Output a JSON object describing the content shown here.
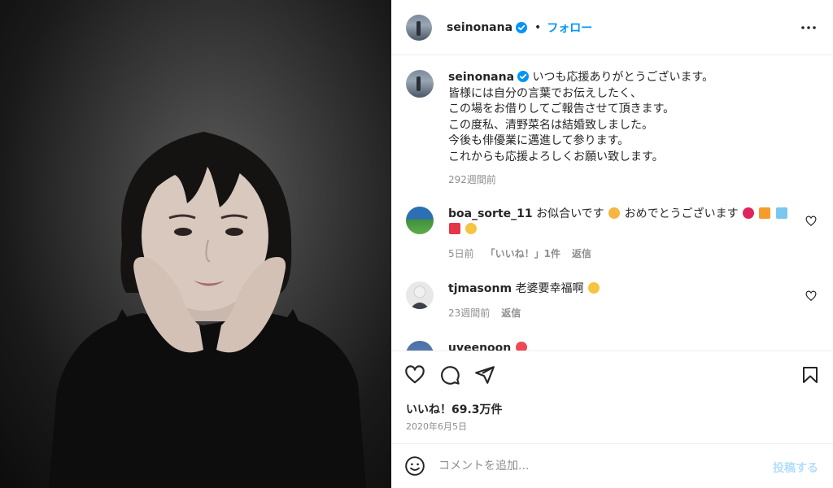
{
  "post": {
    "username": "seinonana",
    "follow_label": "フォロー",
    "dot": "•"
  },
  "caption": {
    "username": "seinonana",
    "lines": [
      "いつも応援ありがとうございます。",
      "皆様には自分の言葉でお伝えしたく、",
      "この場をお借りしてご報告させて頂きます。",
      "この度私、清野菜名は結婚致しました。",
      "今後も俳優業に邁進して参ります。",
      "これからも応援よろしくお願い致します。"
    ],
    "time": "292週間前"
  },
  "comments": [
    {
      "username": "boa_sorte_11",
      "text_a": "お似合いです",
      "text_b": "おめでとうございます",
      "time": "5日前",
      "likes": "「いいね！」1件",
      "reply": "返信"
    },
    {
      "username": "tjmasonm",
      "text": "老婆要幸福啊",
      "time": "23週間前",
      "reply": "返信"
    },
    {
      "username": "uveenoon",
      "text": ""
    }
  ],
  "stats": {
    "likes": "いいね！69.3万件",
    "date": "2020年6月5日"
  },
  "composer": {
    "placeholder": "コメントを追加...",
    "post_label": "投稿する"
  },
  "icons": {
    "more": "more-horizontal-icon",
    "like": "heart-icon",
    "comment": "comment-icon",
    "share": "paper-plane-icon",
    "save": "bookmark-icon",
    "emoji": "smiley-icon",
    "verified": "verified-badge-icon"
  },
  "colors": {
    "accent": "#0095f6",
    "verified": "#0095f6",
    "muted": "#8e8e8e",
    "post_disabled": "#b2dffc"
  }
}
